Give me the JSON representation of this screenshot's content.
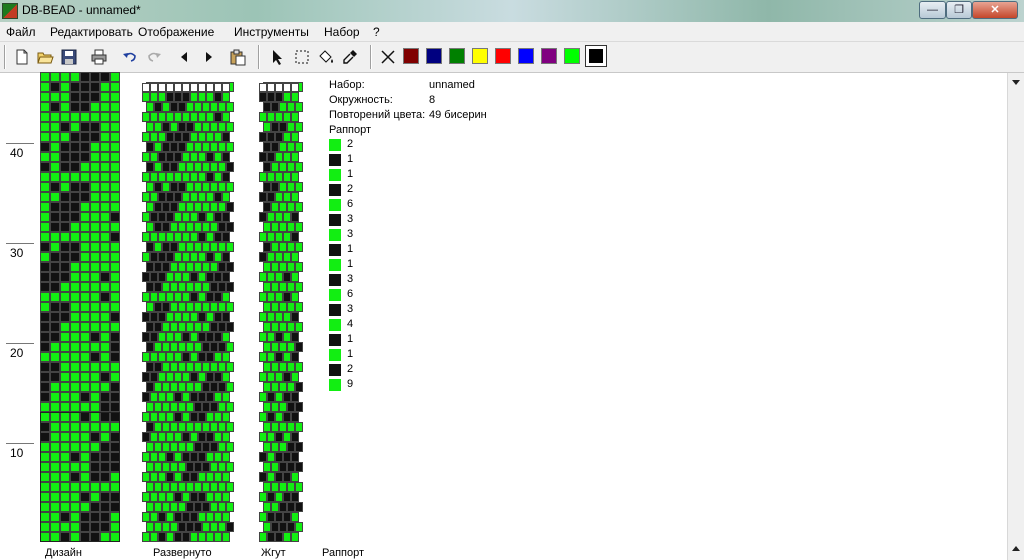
{
  "window": {
    "title": "DB-BEAD - unnamed*"
  },
  "menu": [
    "Файл",
    "Редактировать",
    "Отображение",
    "Инструменты",
    "Набор",
    "?"
  ],
  "toolbar": {
    "icons": [
      "new-file-icon",
      "open-folder-icon",
      "save-icon",
      "print-icon",
      "undo-icon",
      "redo-icon",
      "arrow-left-icon",
      "arrow-right-icon",
      "paste-icon",
      "pointer-icon",
      "select-rect-icon",
      "fill-bucket-icon",
      "eyedropper-icon",
      "clear-color-icon"
    ],
    "palette": [
      "#800000",
      "#000080",
      "#008000",
      "#ffff00",
      "#ff0000",
      "#0000ff",
      "#800080",
      "#00ff00"
    ],
    "selected_color": "#000000"
  },
  "colors": {
    "green": "#12ee12",
    "black": "#111111",
    "empty": "#ffffff"
  },
  "ruler": [
    "40",
    "30",
    "20",
    "10"
  ],
  "info": {
    "set_label": "Набор:",
    "set_value": "unnamed",
    "circ_label": "Окружность:",
    "circ_value": "8",
    "repeat_label": "Повторений цвета:",
    "repeat_value": "49 бисерин",
    "rapport_label": "Раппорт"
  },
  "rapport": [
    {
      "color": "green",
      "count": "2"
    },
    {
      "color": "black",
      "count": "1"
    },
    {
      "color": "green",
      "count": "1"
    },
    {
      "color": "black",
      "count": "2"
    },
    {
      "color": "green",
      "count": "6"
    },
    {
      "color": "black",
      "count": "3"
    },
    {
      "color": "green",
      "count": "3"
    },
    {
      "color": "black",
      "count": "1"
    },
    {
      "color": "green",
      "count": "1"
    },
    {
      "color": "black",
      "count": "3"
    },
    {
      "color": "green",
      "count": "6"
    },
    {
      "color": "black",
      "count": "3"
    },
    {
      "color": "green",
      "count": "4"
    },
    {
      "color": "black",
      "count": "1"
    },
    {
      "color": "green",
      "count": "1"
    },
    {
      "color": "black",
      "count": "2"
    },
    {
      "color": "green",
      "count": "9"
    }
  ],
  "columns": {
    "design": "Дизайн",
    "unrolled": "Развернуто",
    "rope": "Жгут",
    "rapport": "Раппорт"
  }
}
